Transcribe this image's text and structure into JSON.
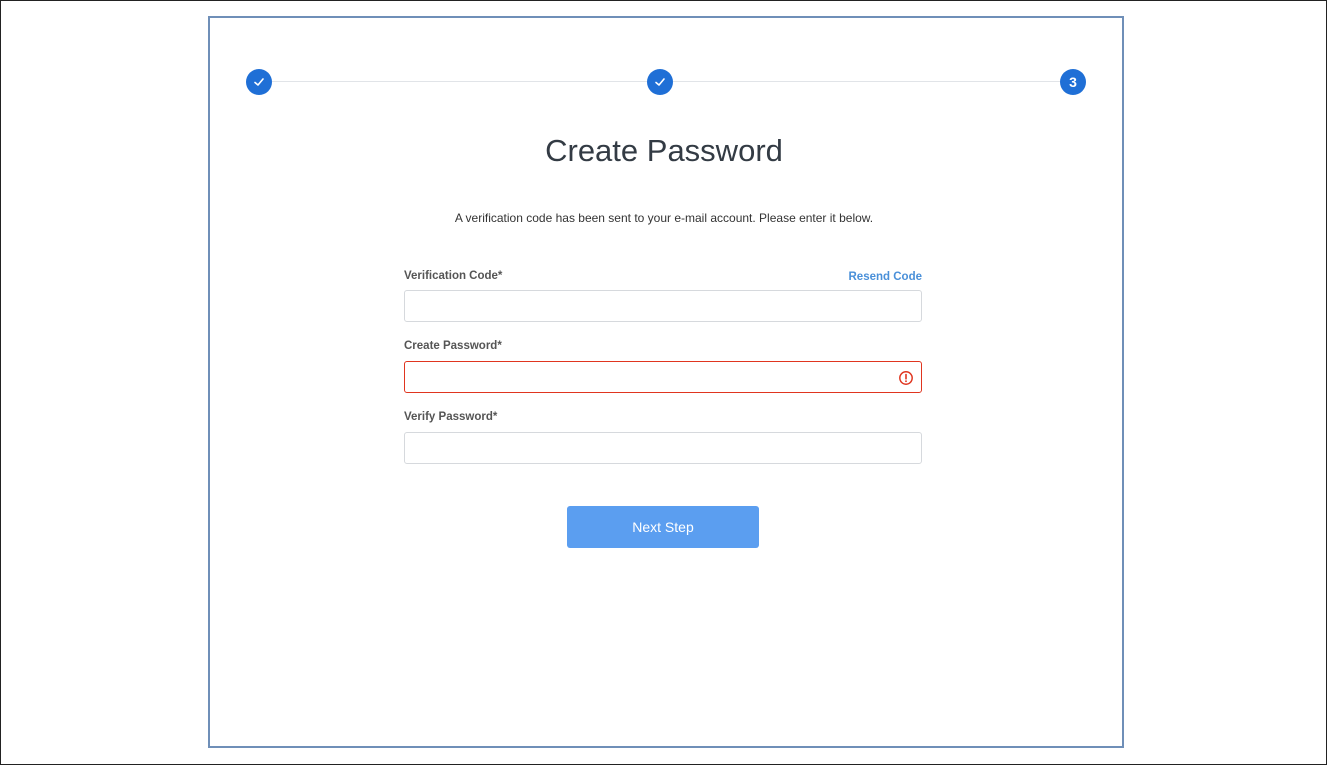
{
  "stepper": {
    "steps": [
      {
        "state": "done",
        "icon": "check-icon"
      },
      {
        "state": "done",
        "icon": "check-icon"
      },
      {
        "state": "current",
        "label": "3"
      }
    ],
    "active_color": "#1f6fd6"
  },
  "form": {
    "title": "Create Password",
    "subtitle": "A verification code has been sent to your e-mail account. Please enter it below.",
    "verification_label": "Verification Code*",
    "resend_label": "Resend Code",
    "verification_value": "",
    "password_label": "Create Password*",
    "password_value": "",
    "password_error_icon": "alert-circle-icon",
    "verify_label": "Verify Password*",
    "verify_value": "",
    "next_label": "Next Step"
  },
  "colors": {
    "accent": "#5b9ef0",
    "link": "#4a90d9",
    "error": "#e0351f"
  }
}
